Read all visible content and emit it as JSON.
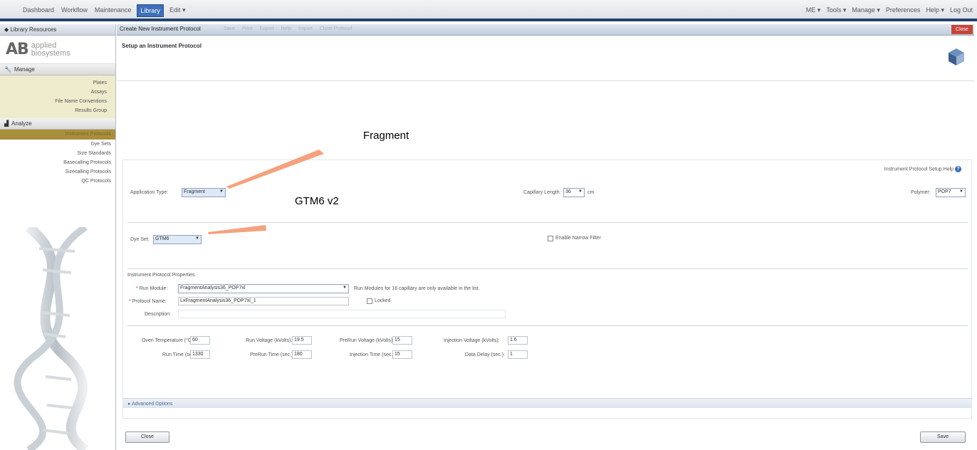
{
  "menu": {
    "left": [
      "Dashboard",
      "Workflow",
      "Maintenance",
      "Library",
      "Edit ▾"
    ],
    "right": [
      "ME ▾",
      "Tools ▾",
      "Manage ▾",
      "Preferences",
      "Help ▾",
      "Log Out"
    ]
  },
  "sidebar": {
    "header": "Library Resources",
    "logo_letters": "AB",
    "logo_line1": "applied",
    "logo_line2": "biosystems",
    "manage_label": "Manage",
    "manage_items": [
      "Plates",
      "Assays",
      "File Name Conventions",
      "Results Group"
    ],
    "analyze_label": "Analyze",
    "analyze_items": [
      "Instrument Protocols",
      "Dye Sets",
      "Size Standards",
      "Basecalling Protocols",
      "Sizecalling Protocols",
      "QC Protocols"
    ]
  },
  "tab": {
    "title": "Create New Instrument Protocol",
    "tools": [
      "Save",
      "Print",
      "Export",
      "Help",
      "Import",
      "Close Protocol"
    ],
    "close_label": "Close"
  },
  "page_title": "Setup an Instrument Protocol",
  "form": {
    "help_link": "Instrument Protocol Setup Help",
    "application_type_label": "Application Type:",
    "application_type_value": "Fragment",
    "capillary_length_label": "Capillary Length:",
    "capillary_length_value": "36",
    "capillary_length_unit": "cm",
    "polymer_label": "Polymer:",
    "polymer_value": "POP7",
    "dye_set_label": "Dye Set:",
    "dye_set_value": "GTM6",
    "enable_filter_label": "Enable Narrow Filter",
    "properties_heading": "Instrument Protocol Properties",
    "run_module_label": "Run Module:",
    "run_module_value": "FragmentAnalysis36_POP7xl",
    "run_module_note": "Run Modules for 16 capillary are only available in the list.",
    "protocol_name_label": "Protocol Name:",
    "protocol_name_value": "LxFragmentAnalysis36_POP7xl_1",
    "locked_label": "Locked",
    "description_label": "Description:",
    "description_value": "",
    "oven_temp_label": "Oven Temperature (°C):",
    "oven_temp_value": "60",
    "run_voltage_label": "Run Voltage (kVolts):",
    "run_voltage_value": "19.5",
    "prerun_voltage_label": "PreRun Voltage (kVolts):",
    "prerun_voltage_value": "15",
    "injection_voltage_label": "Injection Voltage (kVolts):",
    "injection_voltage_value": "1.6",
    "run_time_label": "Run Time (sec.):",
    "run_time_value": "1330",
    "prerun_time_label": "PreRun Time (sec.):",
    "prerun_time_value": "180",
    "injection_time_label": "Injection Time (sec.):",
    "injection_time_value": "15",
    "data_delay_label": "Data Delay (sec.):",
    "data_delay_value": "1",
    "advanced_label": "Advanced Options"
  },
  "buttons": {
    "close": "Close",
    "save": "Save"
  },
  "annotations": {
    "fragment": "Fragment",
    "dyeset": "GTM6 v2"
  },
  "colors": {
    "accent": "#24406e",
    "annotation_arrow": "#f4a27e",
    "selected_item": "#a88f3c"
  }
}
